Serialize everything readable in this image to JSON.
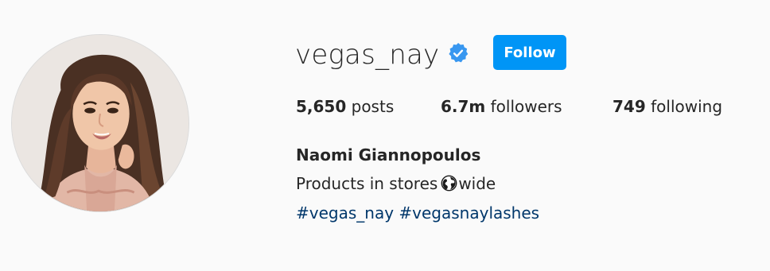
{
  "profile": {
    "username": "vegas_nay",
    "verified": true,
    "verified_icon": "verified-badge-icon",
    "follow_label": "Follow",
    "accent_color": "#0095f6",
    "avatar_icon": "profile-avatar"
  },
  "stats": {
    "posts": {
      "value": "5,650",
      "label": "posts"
    },
    "followers": {
      "value": "6.7m",
      "label": "followers"
    },
    "following": {
      "value": "749",
      "label": "following"
    }
  },
  "bio": {
    "full_name": "Naomi Giannopoulos",
    "line_prefix": "Products in stores",
    "line_icon": "globe-icon",
    "line_suffix": "wide",
    "hashtags": [
      "#vegas_nay",
      "#vegasnaylashes"
    ],
    "hashtag_color": "#00376b"
  }
}
